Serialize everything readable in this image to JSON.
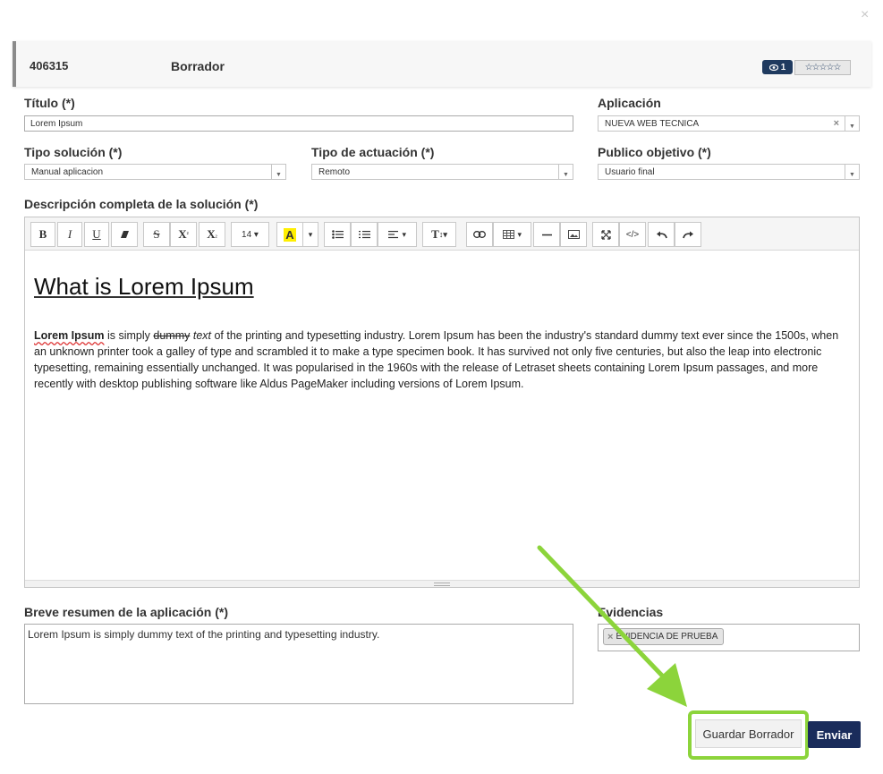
{
  "header": {
    "id": "406315",
    "status": "Borrador",
    "views": "1",
    "rating": "☆☆☆☆☆"
  },
  "form": {
    "titulo_label": "Título (*)",
    "titulo_value": "Lorem Ipsum",
    "aplicacion_label": "Aplicación",
    "aplicacion_value": "NUEVA WEB TECNICA",
    "tipo_solucion_label": "Tipo solución (*)",
    "tipo_solucion_value": "Manual aplicacion",
    "tipo_actuacion_label": "Tipo de actuación (*)",
    "tipo_actuacion_value": "Remoto",
    "publico_label": "Publico objetivo (*)",
    "publico_value": "Usuario final",
    "descripcion_label": "Descripción completa de la solución (*)",
    "resumen_label": "Breve resumen de la aplicación (*)",
    "resumen_value": "Lorem Ipsum is simply dummy text of the printing and typesetting industry.",
    "evidencias_label": "Evidencias",
    "evidencia_tag": "EVIDENCIA DE PRUEBA"
  },
  "toolbar": {
    "font_size": "14"
  },
  "editor": {
    "heading": "What is Lorem Ipsum",
    "p_bold": "Lorem Ipsum",
    "p_is_simply": " is simply ",
    "p_strike": "dummy",
    "p_italic": "text",
    "p_rest": " of the printing and typesetting industry. Lorem Ipsum has been the industry's standard dummy text ever since the 1500s, when an unknown printer took a galley of type and scrambled it to make a type specimen book. It has survived not only five centuries, but also the leap into electronic typesetting, remaining essentially unchanged. It was popularised in the 1960s with the release of Letraset sheets containing Lorem Ipsum passages, and more recently with desktop publishing software like Aldus PageMaker including versions of Lorem Ipsum."
  },
  "buttons": {
    "save_draft": "Guardar Borrador",
    "send": "Enviar",
    "close": "×"
  },
  "colors": {
    "primary": "#1a2c5b",
    "highlight": "#8cd43b"
  }
}
